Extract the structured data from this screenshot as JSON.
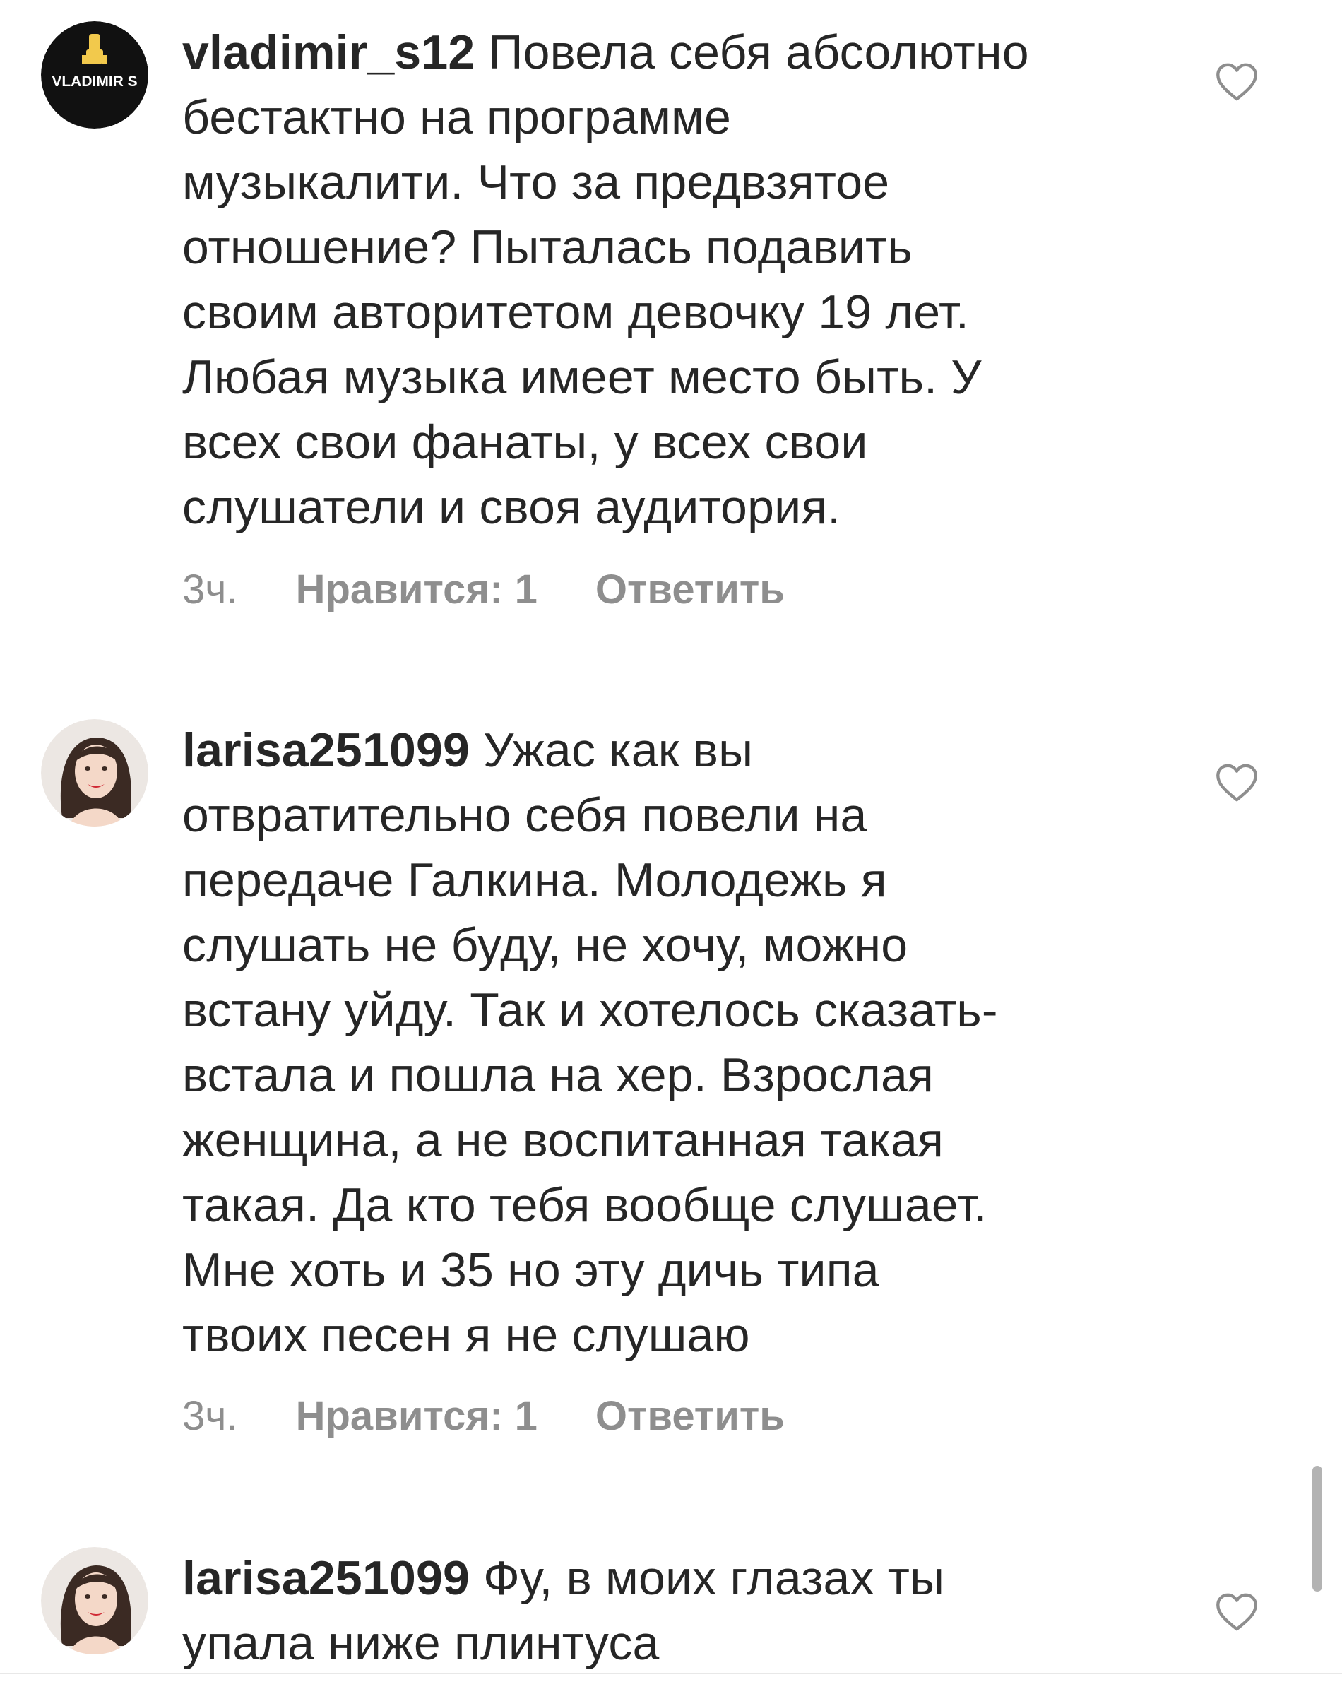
{
  "comments": [
    {
      "username": "vladimir_s12",
      "avatar_text": "VLADIMIR S",
      "lines": [
        "Повела себя абсолютно",
        "бестактно на программе",
        "музыкалити. Что за предвзятое",
        "отношение? Пыталась подавить",
        "своим авторитетом девочку 19 лет.",
        "Любая музыка имеет место быть. У",
        "всех свои фанаты, у всех свои",
        "слушатели и своя аудитория."
      ],
      "time": "3ч.",
      "likes": "Нравится: 1",
      "reply": "Ответить",
      "like_icon": "heart-outline-icon"
    },
    {
      "username": "larisa251099",
      "lines": [
        "Ужас как вы",
        "отвратительно себя повели на",
        "передаче Галкина. Молодежь я",
        "слушать не буду, не хочу, можно",
        "встану уйду. Так и хотелось сказать-",
        "встала и пошла на хер. Взрослая",
        "женщина, а не воспитанная такая",
        "такая. Да кто тебя вообще слушает.",
        "Мне хоть и 35 но эту дичь типа",
        "твоих песен я не слушаю"
      ],
      "time": "3ч.",
      "likes": "Нравится: 1",
      "reply": "Ответить",
      "like_icon": "heart-outline-icon"
    },
    {
      "username": "larisa251099",
      "lines": [
        "Фу, в моих глазах ты",
        "упала ниже плинтуса"
      ],
      "like_icon": "heart-outline-icon"
    }
  ],
  "colors": {
    "text": "#262626",
    "meta": "#8e8e8e",
    "avatar_bg": "#111111",
    "scrollbar": "#b3b3b3"
  }
}
